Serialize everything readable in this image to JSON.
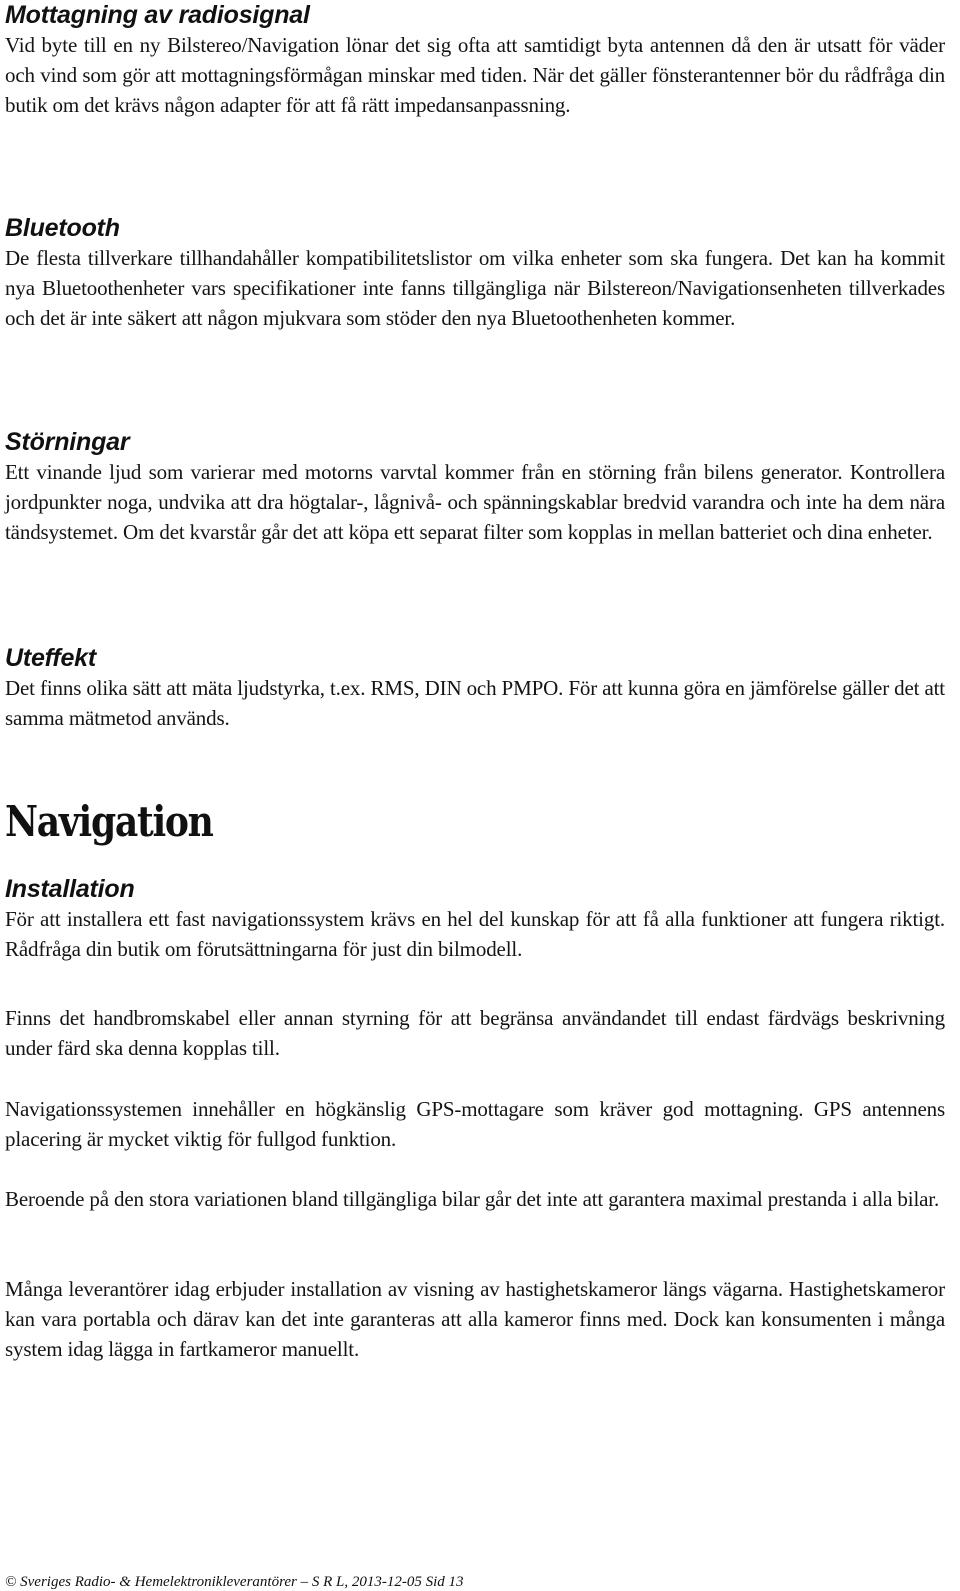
{
  "sections": {
    "radio": {
      "heading": "Mottagning av radiosignal",
      "paragraph": "Vid byte till en ny Bilstereo/Navigation lönar det sig ofta att samtidigt byta antennen då den är utsatt för väder och vind som gör att mottagningsförmågan minskar med tiden. När det gäller fönsterantenner bör du rådfråga din butik om det krävs någon adapter för att få rätt impedansanpassning."
    },
    "bluetooth": {
      "heading": "Bluetooth",
      "paragraph": "De flesta tillverkare tillhandahåller kompatibilitetslistor om vilka enheter som ska fungera. Det kan ha kommit nya Bluetoothenheter vars specifikationer inte fanns tillgängliga när Bilstereon/Navigationsenheten tillverkades och det är inte säkert att någon mjukvara som stöder den nya Bluetoothenheten kommer."
    },
    "storningar": {
      "heading": "Störningar",
      "paragraph": "Ett vinande ljud som varierar med motorns varvtal kommer från en störning från bilens generator. Kontrollera jordpunkter noga, undvika att dra högtalar-, lågnivå- och spänningskablar bredvid varandra och inte ha dem nära tändsystemet. Om det kvarstår går det att köpa ett separat filter som kopplas in mellan batteriet och dina enheter."
    },
    "uteffekt": {
      "heading": "Uteffekt",
      "paragraph": "Det finns olika sätt att mäta ljudstyrka, t.ex. RMS, DIN och PMPO. För att kunna göra en jämförelse gäller det att samma mätmetod används."
    },
    "navigation": {
      "title": "Navigation",
      "installation_heading": "Installation",
      "paragraphs": [
        "För att installera ett fast navigationssystem krävs en hel del kunskap för att få alla funkt­ioner att fungera riktigt. Rådfråga din butik om förutsättningarna för just din bilmodell.",
        "Finns det handbromskabel eller annan styrning för att begränsa användandet till endast färdvägs beskrivning under färd ska denna kopplas till.",
        "Navigationssystemen innehåller en högkänslig GPS-mottagare som kräver god mottagning. GPS antennens placering är mycket viktig för fullgod funktion.",
        "Beroende på den stora variationen bland tillgängliga bilar går det inte att garantera maxi­mal prestanda i alla bilar.",
        "Många leverantörer idag erbjuder installation av visning av hastighetskameror längs vägarna. Hastighetskameror kan vara portabla och därav kan det inte garanteras att alla kameror finns med. Dock kan konsumenten i många system idag lägga in fartkameror manuellt."
      ]
    }
  },
  "footer": {
    "text": "© Sveriges Radio- & Hemelektronikleverantörer – S R L, 2013-12-05  Sid 13"
  }
}
